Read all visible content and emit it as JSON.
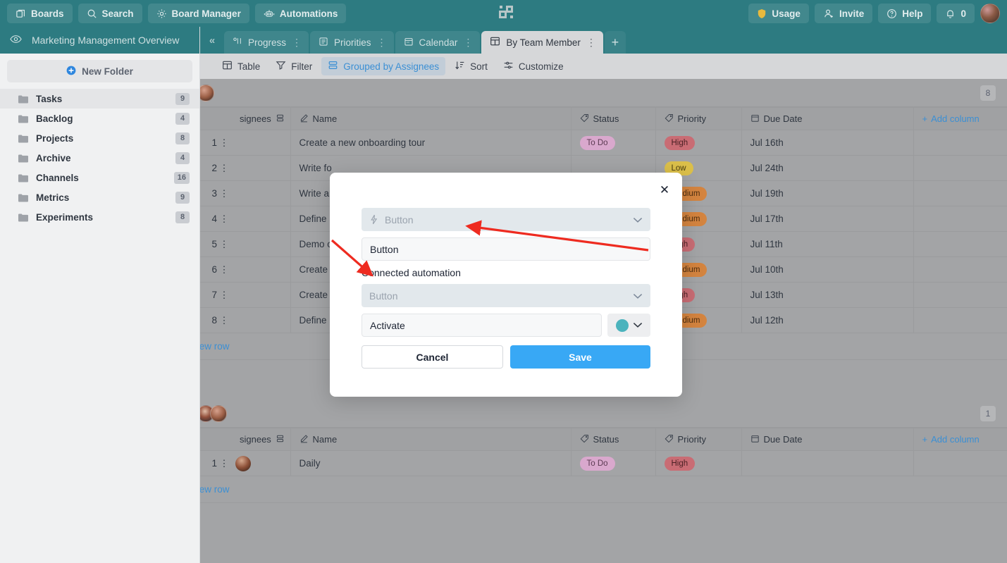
{
  "topbar": {
    "items": [
      {
        "label": "Boards",
        "icon": "boards-icon"
      },
      {
        "label": "Search",
        "icon": "search-icon"
      },
      {
        "label": "Board Manager",
        "icon": "gear-icon"
      },
      {
        "label": "Automations",
        "icon": "robot-icon"
      }
    ],
    "right": [
      {
        "label": "Usage",
        "icon": "shield-icon"
      },
      {
        "label": "Invite",
        "icon": "user-add-icon"
      },
      {
        "label": "Help",
        "icon": "question-icon"
      },
      {
        "label": "0",
        "icon": "bell-icon"
      }
    ]
  },
  "sidebar": {
    "title": "Marketing Management Overview",
    "new_folder": "New Folder",
    "items": [
      {
        "label": "Tasks",
        "count": "9",
        "active": true
      },
      {
        "label": "Backlog",
        "count": "4",
        "active": false
      },
      {
        "label": "Projects",
        "count": "8",
        "active": false
      },
      {
        "label": "Archive",
        "count": "4",
        "active": false
      },
      {
        "label": "Channels",
        "count": "16",
        "active": false
      },
      {
        "label": "Metrics",
        "count": "9",
        "active": false
      },
      {
        "label": "Experiments",
        "count": "8",
        "active": false
      }
    ]
  },
  "tabs": [
    {
      "label": "Progress",
      "icon": "progress-icon",
      "active": false
    },
    {
      "label": "Priorities",
      "icon": "list-icon",
      "active": false
    },
    {
      "label": "Calendar",
      "icon": "calendar-icon",
      "active": false
    },
    {
      "label": "By Team Member",
      "icon": "table-icon",
      "active": true
    }
  ],
  "tab_add": "+",
  "toolbar": [
    {
      "label": "Table",
      "icon": "table-icon",
      "active": false
    },
    {
      "label": "Filter",
      "icon": "filter-icon",
      "active": false
    },
    {
      "label": "Grouped by Assignees",
      "icon": "group-icon",
      "active": true
    },
    {
      "label": "Sort",
      "icon": "sort-icon",
      "active": false
    },
    {
      "label": "Customize",
      "icon": "sliders-icon",
      "active": false
    }
  ],
  "grid": {
    "columns": [
      "signees",
      "Name",
      "Status",
      "Priority",
      "Due Date"
    ],
    "add_column": "Add column",
    "add_row": "d new row",
    "groups": [
      {
        "count": "8",
        "avatars": 1,
        "rows": [
          {
            "n": "1",
            "name": "Create a new onboarding tour",
            "status": "To Do",
            "priority": "High",
            "due": "Jul 16th"
          },
          {
            "n": "2",
            "name": "Write fo",
            "status": "",
            "priority": "Low",
            "due": "Jul 24th"
          },
          {
            "n": "3",
            "name": "Write an",
            "status": "",
            "priority": "Medium",
            "due": "Jul 19th"
          },
          {
            "n": "4",
            "name": "Define",
            "status": "",
            "priority": "Medium",
            "due": "Jul 17th"
          },
          {
            "n": "5",
            "name": "Demo o",
            "status": "",
            "priority": "High",
            "due": "Jul 11th"
          },
          {
            "n": "6",
            "name": "Create",
            "status": "",
            "priority": "Medium",
            "due": "Jul 10th"
          },
          {
            "n": "7",
            "name": "Create",
            "status": "",
            "priority": "High",
            "due": "Jul 13th"
          },
          {
            "n": "8",
            "name": "Define",
            "status": "",
            "priority": "Medium",
            "due": "Jul 12th"
          }
        ]
      },
      {
        "count": "1",
        "avatars": 2,
        "rows": [
          {
            "n": "1",
            "name": "Daily",
            "status": "To Do",
            "priority": "High",
            "due": ""
          }
        ]
      }
    ]
  },
  "modal": {
    "trigger_placeholder": "Button",
    "name_value": "Button",
    "connected_label": "Connected automation",
    "automation_placeholder": "Button",
    "action_value": "Activate",
    "color": "#4bb3bd",
    "cancel": "Cancel",
    "save": "Save",
    "close": "✕"
  },
  "colors": {
    "brand_teal": "#2d7b81",
    "accent_blue": "#38a8f5",
    "link_blue": "#3b8fd4",
    "annotation_red": "#ee2b20"
  }
}
